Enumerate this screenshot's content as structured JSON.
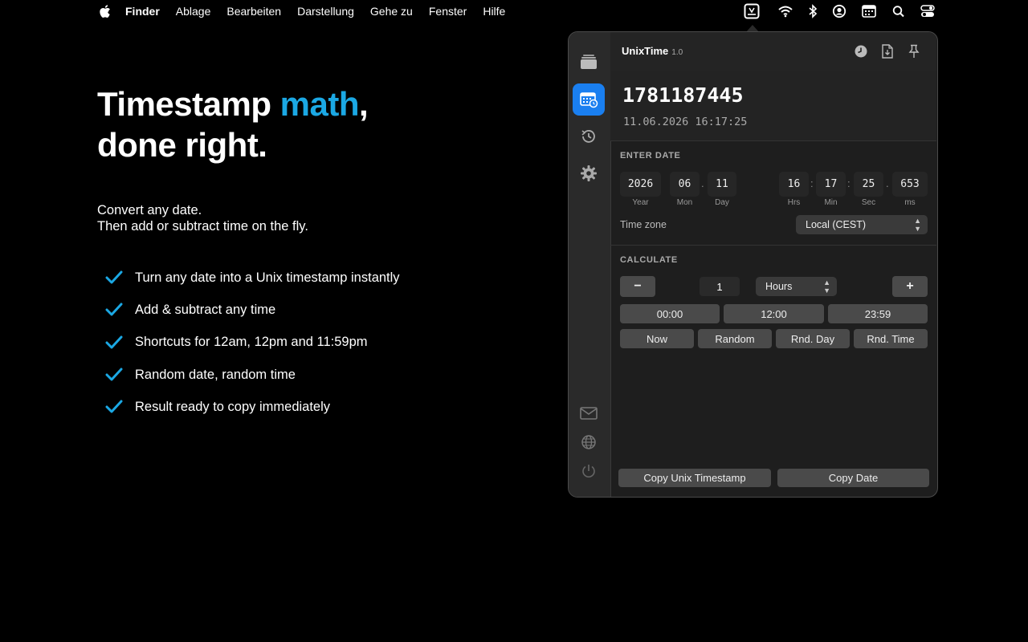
{
  "menubar": {
    "items": [
      "Finder",
      "Ablage",
      "Bearbeiten",
      "Darstellung",
      "Gehe zu",
      "Fenster",
      "Hilfe"
    ],
    "icons": [
      "apple-icon",
      "unixtime-menubar-icon",
      "wifi-icon",
      "bluetooth-icon",
      "user-icon",
      "calendar-icon",
      "search-icon",
      "control-center-icon"
    ]
  },
  "hero": {
    "title_part1": "Timestamp ",
    "title_accent": "math",
    "title_part2": ",",
    "title_line2": "done right.",
    "subtitle_line1": "Convert any date.",
    "subtitle_line2": "Then add or subtract time on the fly.",
    "features": [
      "Turn any date into a Unix timestamp instantly",
      "Add & subtract any time",
      "Shortcuts for 12am, 12pm and 11:59pm",
      "Random date, random time",
      "Result ready to copy immediately"
    ],
    "accent_color": "#1ba8e4"
  },
  "app": {
    "name": "UnixTime",
    "version": "1.0",
    "timestamp": "1781187445",
    "date_display": "11.06.2026 16:17:25",
    "enter_date_label": "ENTER DATE",
    "fields": {
      "year": {
        "value": "2026",
        "label": "Year"
      },
      "month": {
        "value": "06",
        "label": "Mon"
      },
      "day": {
        "value": "11",
        "label": "Day"
      },
      "hours": {
        "value": "16",
        "label": "Hrs"
      },
      "minutes": {
        "value": "17",
        "label": "Min"
      },
      "seconds": {
        "value": "25",
        "label": "Sec"
      },
      "ms": {
        "value": "653",
        "label": "ms"
      }
    },
    "timezone_label": "Time zone",
    "timezone_value": "Local (CEST)",
    "calculate_label": "CALCULATE",
    "minus_label": "−",
    "plus_label": "+",
    "amount": "1",
    "unit": "Hours",
    "time_shortcuts": [
      "00:00",
      "12:00",
      "23:59"
    ],
    "actions": [
      "Now",
      "Random",
      "Rnd. Day",
      "Rnd. Time"
    ],
    "copy_timestamp": "Copy Unix Timestamp",
    "copy_date": "Copy Date",
    "active_color": "#1a7ff0"
  }
}
